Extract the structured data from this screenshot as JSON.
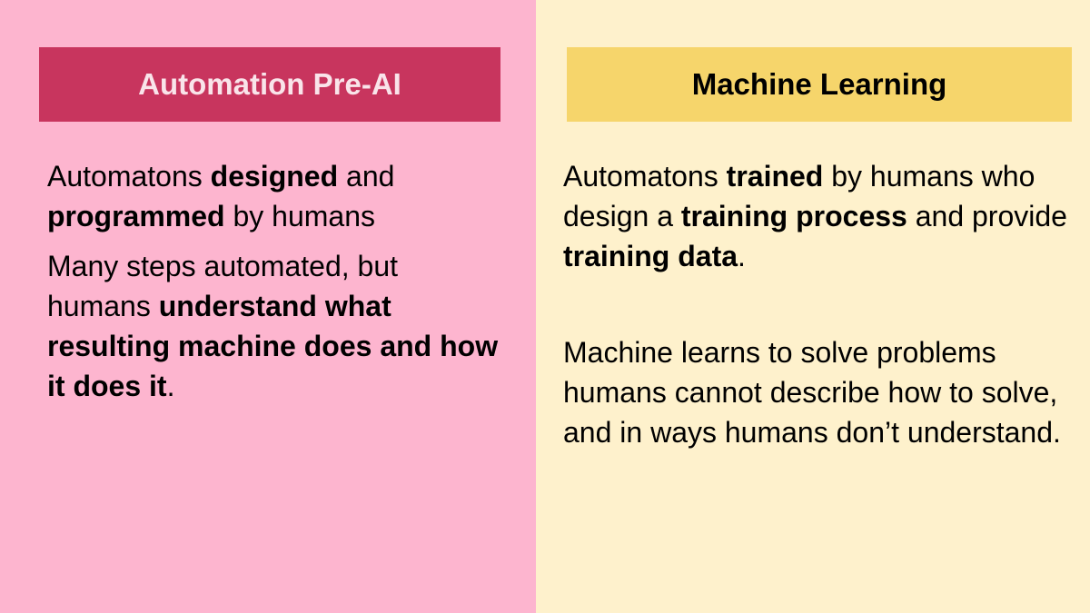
{
  "left": {
    "header": "Automation Pre-AI",
    "p1": {
      "t1": "Automatons ",
      "b1": "designed",
      "t2": " and ",
      "b2": "programmed",
      "t3": " by humans"
    },
    "p2": {
      "t1": "Many steps automated, but humans ",
      "b1": "understand what resulting machine does and how it does it",
      "t2": "."
    }
  },
  "right": {
    "header": "Machine Learning",
    "p1": {
      "t1": "Automatons ",
      "b1": "trained",
      "t2": " by humans who design a ",
      "b2": "training process",
      "t3": " and provide ",
      "b3": "training data",
      "t4": "."
    },
    "p2": {
      "t1": "Machine learns to solve problems humans cannot describe how to solve, and in ways humans don’t understand."
    }
  },
  "colors": {
    "left_background": "#fdb5cf",
    "left_header": "#c8355e",
    "right_background": "#fef1cc",
    "right_header": "#f6d56b"
  }
}
